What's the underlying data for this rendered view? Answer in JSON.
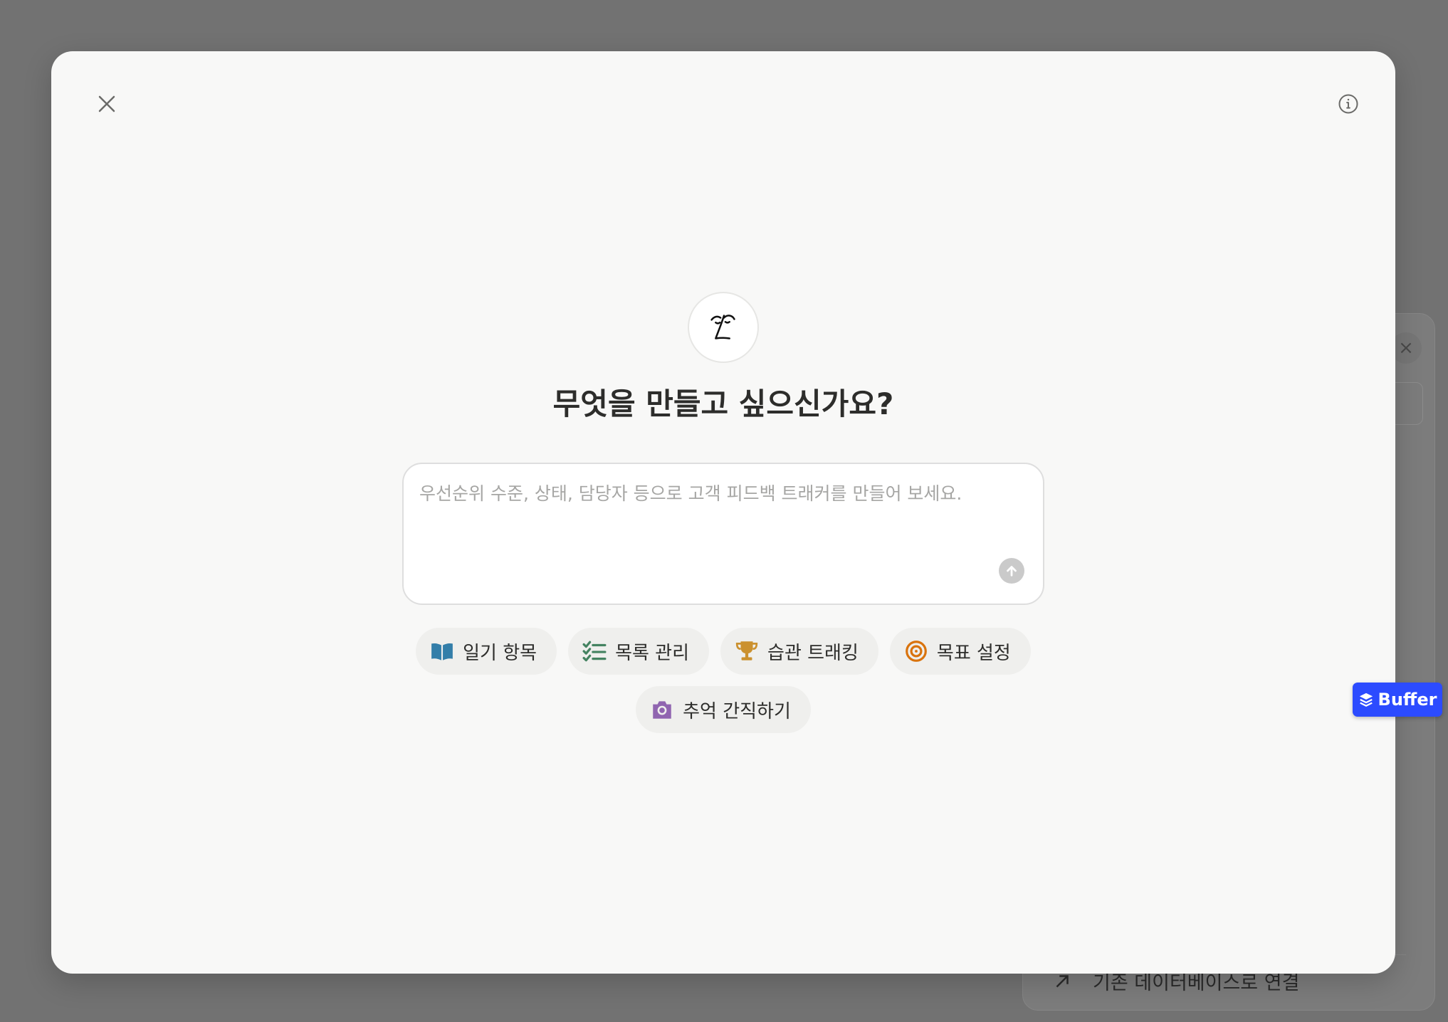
{
  "background": {
    "link_label": "기존 데이터베이스로 연결",
    "close_glyph": "×"
  },
  "modal": {
    "title": "무엇을 만들고 싶으신가요?",
    "prompt": {
      "placeholder": "우선순위 수준, 상태, 담당자 등으로 고객 피드백 트래커를 만들어 보세요.",
      "value": ""
    },
    "chips": [
      {
        "label": "일기 항목",
        "icon": "book-icon",
        "color": "#337ea9"
      },
      {
        "label": "목록 관리",
        "icon": "checklist-icon",
        "color": "#448361"
      },
      {
        "label": "습관 트래킹",
        "icon": "trophy-icon",
        "color": "#cb912f"
      },
      {
        "label": "목표 설정",
        "icon": "target-icon",
        "color": "#d9730d"
      },
      {
        "label": "추억 간직하기",
        "icon": "camera-icon",
        "color": "#9065b0"
      }
    ]
  },
  "extension": {
    "label": "Buffer",
    "color": "#2c4bff"
  }
}
